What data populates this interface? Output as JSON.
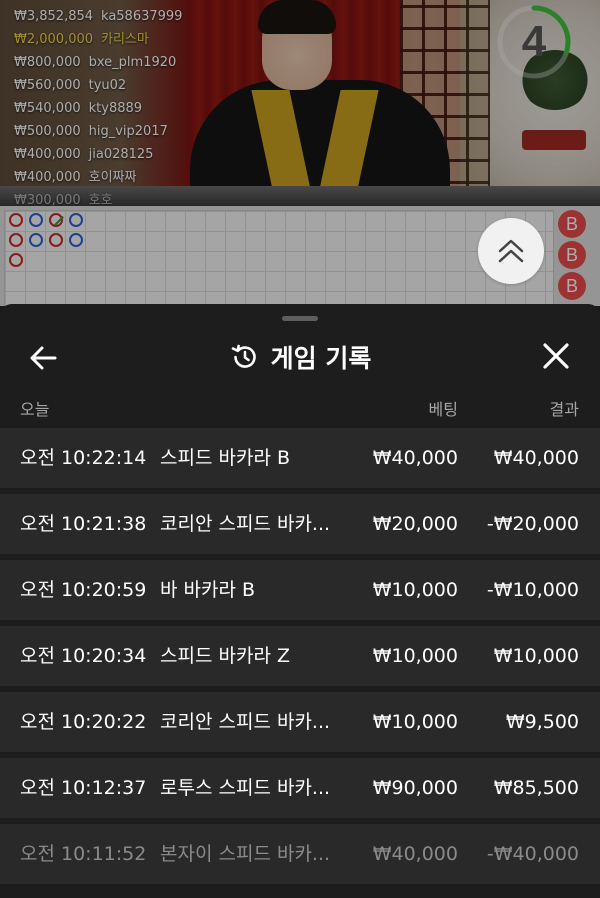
{
  "ticker": [
    {
      "amount": "₩3,852,854",
      "user": "ka58637999",
      "highlight": false
    },
    {
      "amount": "₩2,000,000",
      "user": "카리스마",
      "highlight": true
    },
    {
      "amount": "₩800,000",
      "user": "bxe_plm1920",
      "highlight": false
    },
    {
      "amount": "₩560,000",
      "user": "tyu02",
      "highlight": false
    },
    {
      "amount": "₩540,000",
      "user": "kty8889",
      "highlight": false
    },
    {
      "amount": "₩500,000",
      "user": "hig_vip2017",
      "highlight": false
    },
    {
      "amount": "₩400,000",
      "user": "jia028125",
      "highlight": false
    },
    {
      "amount": "₩400,000",
      "user": "호이짜짜",
      "highlight": false
    },
    {
      "amount": "₩300,000",
      "user": "호호",
      "highlight": false
    }
  ],
  "countdown": {
    "value": "4",
    "progress_fraction": 0.3,
    "ring_color": "#3fbf3f"
  },
  "scoreboard": {
    "side_labels": [
      "B",
      "B",
      "B"
    ],
    "beads": [
      {
        "col": 0,
        "row": 0,
        "color": "red"
      },
      {
        "col": 1,
        "row": 0,
        "color": "blue"
      },
      {
        "col": 2,
        "row": 0,
        "color": "red",
        "tie_mark": true
      },
      {
        "col": 3,
        "row": 0,
        "color": "blue"
      },
      {
        "col": 0,
        "row": 1,
        "color": "red"
      },
      {
        "col": 1,
        "row": 1,
        "color": "blue"
      },
      {
        "col": 2,
        "row": 1,
        "color": "red"
      },
      {
        "col": 3,
        "row": 1,
        "color": "blue"
      },
      {
        "col": 0,
        "row": 2,
        "color": "red"
      }
    ]
  },
  "sheet": {
    "title": "게임 기록",
    "icons": {
      "back": "arrow-left-icon",
      "history": "history-icon",
      "close": "close-icon",
      "expand": "chevron-up-icon"
    },
    "columns": {
      "date": "오늘",
      "bet": "베팅",
      "result": "결과"
    },
    "rows": [
      {
        "time": "오전 10:22:14",
        "game": "스피드 바카라 B",
        "bet": "₩40,000",
        "result": "₩40,000"
      },
      {
        "time": "오전 10:21:38",
        "game": "코리안 스피드 바카...",
        "bet": "₩20,000",
        "result": "-₩20,000"
      },
      {
        "time": "오전 10:20:59",
        "game": "바 바카라 B",
        "bet": "₩10,000",
        "result": "-₩10,000"
      },
      {
        "time": "오전 10:20:34",
        "game": "스피드 바카라 Z",
        "bet": "₩10,000",
        "result": "₩10,000"
      },
      {
        "time": "오전 10:20:22",
        "game": "코리안 스피드 바카...",
        "bet": "₩10,000",
        "result": "₩9,500"
      },
      {
        "time": "오전 10:12:37",
        "game": "로투스 스피드 바카...",
        "bet": "₩90,000",
        "result": "₩85,500"
      },
      {
        "time": "오전 10:11:52",
        "game": "본자이 스피드 바카...",
        "bet": "₩40,000",
        "result": "-₩40,000"
      }
    ]
  },
  "colors": {
    "sheet_bg": "#1d1d1d",
    "row_bg": "#292929",
    "bead_red": "#c62828",
    "bead_blue": "#2e5fd8",
    "side_b": "#e84b4b",
    "ticker_gold": "#f2d44a"
  }
}
